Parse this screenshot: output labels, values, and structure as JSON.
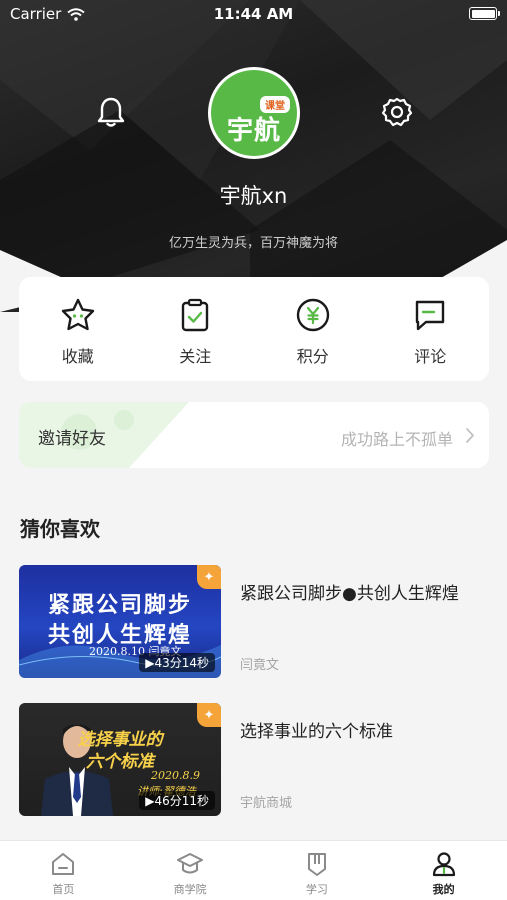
{
  "status_bar": {
    "carrier": "Carrier",
    "time": "11:44 AM"
  },
  "profile": {
    "avatar_tag": "课堂",
    "avatar_text": "宇航",
    "username": "宇航xn",
    "motto": "亿万生灵为兵，百万神魔为将"
  },
  "quick_actions": [
    {
      "label": "收藏",
      "icon": "star-icon"
    },
    {
      "label": "关注",
      "icon": "clipboard-check-icon"
    },
    {
      "label": "积分",
      "icon": "yuan-coin-icon"
    },
    {
      "label": "评论",
      "icon": "comment-icon"
    }
  ],
  "invite": {
    "title": "邀请好友",
    "subtitle": "成功路上不孤单"
  },
  "section": {
    "title": "猜你喜欢"
  },
  "courses": [
    {
      "title": "紧跟公司脚步●共创人生辉煌",
      "author": "闫竟文",
      "thumb_line1": "紧跟公司脚步",
      "thumb_line2": "共创人生辉煌",
      "thumb_date": "2020.8.10  闫竟文",
      "duration": "▶43分14秒"
    },
    {
      "title": "选择事业的六个标准",
      "author": "宇航商城",
      "thumb_line1": "选择事业的",
      "thumb_line2": "六个标准",
      "thumb_date": "2020.8.9",
      "thumb_lecturer": "讲师:翟德浩",
      "duration": "▶46分11秒"
    }
  ],
  "tabs": [
    {
      "label": "首页",
      "icon": "home-icon",
      "active": false
    },
    {
      "label": "商学院",
      "icon": "graduation-cap-icon",
      "active": false
    },
    {
      "label": "学习",
      "icon": "bookmark-icon",
      "active": false
    },
    {
      "label": "我的",
      "icon": "person-icon",
      "active": true
    }
  ],
  "colors": {
    "brand_green": "#58b947",
    "accent_orange": "#f5a43a",
    "hero_dark": "#1c1c1c"
  }
}
